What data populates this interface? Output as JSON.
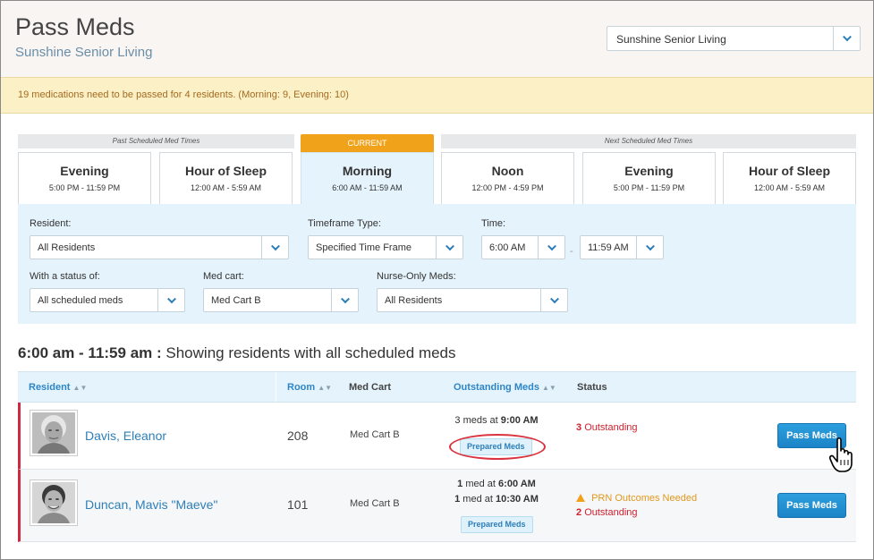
{
  "header": {
    "title": "Pass Meds",
    "subtitle": "Sunshine Senior Living",
    "community_select": "Sunshine Senior Living"
  },
  "alert": {
    "text": "19 medications need to be passed for 4 residents. (Morning: 9, Evening: 10)"
  },
  "timeline": {
    "past_label": "Past Scheduled Med Times",
    "current_label": "CURRENT",
    "next_label": "Next Scheduled Med Times",
    "slots": [
      {
        "name": "Evening",
        "range": "5:00 PM - 11:59 PM"
      },
      {
        "name": "Hour of Sleep",
        "range": "12:00 AM - 5:59 AM"
      },
      {
        "name": "Morning",
        "range": "6:00 AM - 11:59 AM"
      },
      {
        "name": "Noon",
        "range": "12:00 PM - 4:59 PM"
      },
      {
        "name": "Evening",
        "range": "5:00 PM - 11:59 PM"
      },
      {
        "name": "Hour of Sleep",
        "range": "12:00 AM - 5:59 AM"
      }
    ]
  },
  "filters": {
    "resident": {
      "label": "Resident:",
      "value": "All Residents"
    },
    "timeframe_type": {
      "label": "Timeframe Type:",
      "value": "Specified Time Frame"
    },
    "time": {
      "label": "Time:",
      "start": "6:00 AM",
      "end": "11:59 AM",
      "separator": "-"
    },
    "status": {
      "label": "With a status of:",
      "value": "All scheduled meds"
    },
    "med_cart": {
      "label": "Med cart:",
      "value": "Med Cart B"
    },
    "nurse_only": {
      "label": "Nurse-Only Meds:",
      "value": "All Residents"
    }
  },
  "showing": {
    "range": "6:00 am - 11:59 am :",
    "text": "Showing residents with all scheduled meds"
  },
  "table": {
    "headers": {
      "resident": "Resident",
      "room": "Room",
      "med_cart": "Med Cart",
      "outstanding": "Outstanding Meds",
      "status": "Status"
    },
    "sort_glyph": "▲▼",
    "rows": [
      {
        "name": "Davis, Eleanor",
        "room": "208",
        "cart": "Med Cart B",
        "meds": [
          {
            "count": "3 meds at",
            "time": "9:00 AM"
          }
        ],
        "badge": "Prepared Meds",
        "status_prn": "",
        "status_count": "3",
        "status_text": "Outstanding",
        "button": "Pass Meds"
      },
      {
        "name": "Duncan, Mavis \"Maeve\"",
        "room": "101",
        "cart": "Med Cart B",
        "meds": [
          {
            "count": "1",
            "mid": "med at",
            "time": "6:00 AM"
          },
          {
            "count": "1",
            "mid": "med at",
            "time": "10:30 AM"
          }
        ],
        "badge": "Prepared Meds",
        "status_prn": "PRN Outcomes Needed",
        "status_count": "2",
        "status_text": "Outstanding",
        "button": "Pass Meds"
      }
    ]
  },
  "colors": {
    "accent_blue": "#1b84c7",
    "current_orange": "#f0a21a",
    "alert_bg": "#fcf1c6",
    "outstanding_red": "#d0212f",
    "panel_bg": "#e4f3fc"
  },
  "icons": {
    "dropdown": "chevron-down-icon",
    "sort": "sort-icon",
    "warning": "warning-triangle-icon",
    "cursor": "hand-pointer-icon"
  }
}
